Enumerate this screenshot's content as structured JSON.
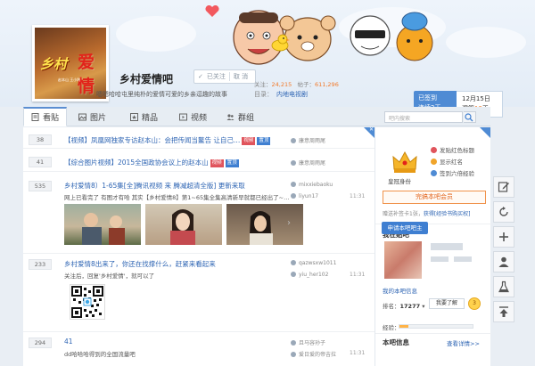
{
  "forum": {
    "name": "乡村爱情吧",
    "follow_label": "已关注",
    "unfollow_label": "取 消",
    "members_label": "关注：",
    "members": "24,215",
    "posts_label": "帖子：",
    "posts": "611,296",
    "slogan": "嗯嗯哈哈屯里纯朴的爱情可爱的乡亲逗趣的故事",
    "catalog_label": "目录：",
    "catalog": "内地电视剧",
    "avatar_text1": "乡村",
    "avatar_text2": "爱情",
    "avatar_sub": "赵本山 王小利"
  },
  "sign": {
    "status": "已签到",
    "streak_label": "连续",
    "streak_value": "2",
    "streak_unit": "天",
    "date": "12月15日",
    "missed_label": "漏签",
    "missed_value": "13",
    "missed_unit": "天"
  },
  "tabs": [
    {
      "label": "看贴",
      "icon": "doc-icon"
    },
    {
      "label": "图片",
      "icon": "image-icon"
    },
    {
      "label": "精品",
      "icon": "star-icon"
    },
    {
      "label": "视频",
      "icon": "video-icon"
    },
    {
      "label": "群组",
      "icon": "group-icon"
    }
  ],
  "search": {
    "placeholder": "吧内搜索"
  },
  "threads": [
    {
      "replies": "38",
      "title": "【视频】凤凰网独家专访赵本山：会把传闻当鳌告 让自己…",
      "badges": [
        "视频",
        "置顶"
      ],
      "author": "康意周雨尾",
      "time": ""
    },
    {
      "replies": "41",
      "title": "【综合图片视频】2015全国政协会议上的赵本山",
      "badges": [
        "视频",
        "置顶"
      ],
      "author": "康意周雨尾",
      "time": ""
    },
    {
      "replies": "535",
      "title": "乡村爱情8）1-65集[全]腾讯视频 来 腾减超清全版] 更新来取",
      "badges": [],
      "abstract": "网上已看完了 有图才有哈 其实【乡村爱情8】第1~65集全集高清新早就都已经出了~…",
      "author": "mixxiebaoku",
      "last_reply": "liyun17",
      "time": "11:31"
    },
    {
      "replies": "233",
      "title": "乡村爱情8出来了，你还在找撑什么，赶紧来看起来",
      "badges": [],
      "abstract": "关注后，回复'乡村爱情'，就可以了",
      "author": "qazwsxw1011",
      "last_reply": "yiu_her102",
      "time": "11:31"
    },
    {
      "replies": "294",
      "title": "41",
      "badges": [],
      "abstract": "dd哈哈哈得到的全国流量吧",
      "author": "且马容孙子",
      "last_reply": "爱日爱的帝吉拉",
      "time": "11:31"
    }
  ],
  "sidebar": {
    "vip_label": "皇冠身份",
    "privileges": [
      {
        "label": "发贴红色标题",
        "color": "#e0545c"
      },
      {
        "label": "显示红名",
        "color": "#f0a42a"
      },
      {
        "label": "签到六倍经验",
        "color": "#4f8bd4"
      }
    ],
    "open_vip": "完搞本吧会员",
    "resign_text": "赠送补签卡1张，",
    "resign_link": "获得[经验书购买权]",
    "my_forum_title": "我在贴吧",
    "my_info_label": "我的本吧信息",
    "rank_label": "排名：",
    "rank_value": "17277",
    "upgrade_btn": "我要了解",
    "level": "3",
    "exp_label": "经验：",
    "exp_fraction": 0.12,
    "forum_info_title": "本吧信息",
    "detail_link": "查看详情>>",
    "apply_btn": "申请本吧吧主"
  },
  "right_tools": [
    {
      "icon": "edit-icon"
    },
    {
      "icon": "refresh-icon"
    },
    {
      "icon": "plus-icon"
    },
    {
      "icon": "user-icon"
    },
    {
      "icon": "flask-icon"
    },
    {
      "icon": "to-top-icon"
    }
  ]
}
